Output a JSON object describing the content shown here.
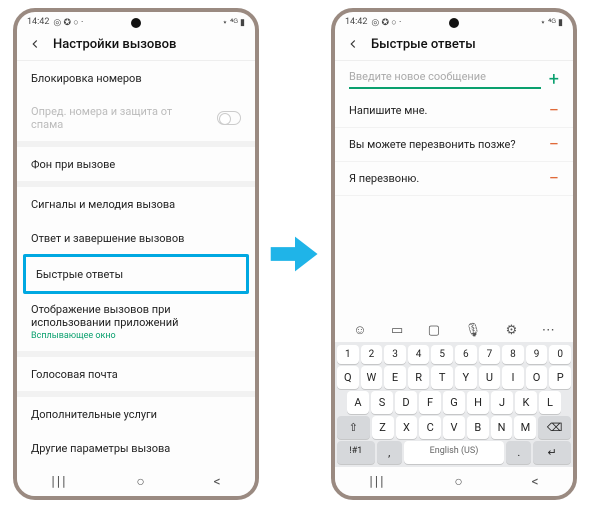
{
  "status": {
    "time": "14:42",
    "icons_left": "◎ ✪ ○ ·",
    "icons_right": "⋆ ⁴ᴳ ▮"
  },
  "left": {
    "title": "Настройки вызовов",
    "items": {
      "block": "Блокировка номеров",
      "spam": "Опред. номера и защита от спама",
      "bg": "Фон при вызове",
      "ring": "Сигналы и мелодия вызова",
      "answer": "Ответ и завершение вызовов",
      "quick": "Быстрые ответы",
      "overlay": "Отображение вызовов при использовании приложений",
      "overlay_sub": "Всплывающее окно",
      "voicemail": "Голосовая почта",
      "extra": "Дополнительные услуги",
      "other": "Другие параметры вызова"
    }
  },
  "right": {
    "title": "Быстрые ответы",
    "placeholder": "Введите новое сообщение",
    "replies": {
      "r1": "Напишите мне.",
      "r2": "Вы можете перезвонить позже?",
      "r3": "Я перезвоню."
    }
  },
  "keyboard": {
    "nums": [
      "1",
      "2",
      "3",
      "4",
      "5",
      "6",
      "7",
      "8",
      "9",
      "0"
    ],
    "row1": [
      "Q",
      "W",
      "E",
      "R",
      "T",
      "Y",
      "U",
      "I",
      "O",
      "P"
    ],
    "row2": [
      "A",
      "S",
      "D",
      "F",
      "G",
      "H",
      "J",
      "K",
      "L"
    ],
    "row3": [
      "Z",
      "X",
      "C",
      "V",
      "B",
      "N",
      "M"
    ],
    "shift": "⇧",
    "bksp": "⌫",
    "sym": "!#1",
    "comma": ",",
    "lang": "English (US)",
    "dot": ".",
    "enter": "↵"
  },
  "nav": {
    "recent": "|||",
    "home": "○",
    "back": "<"
  }
}
